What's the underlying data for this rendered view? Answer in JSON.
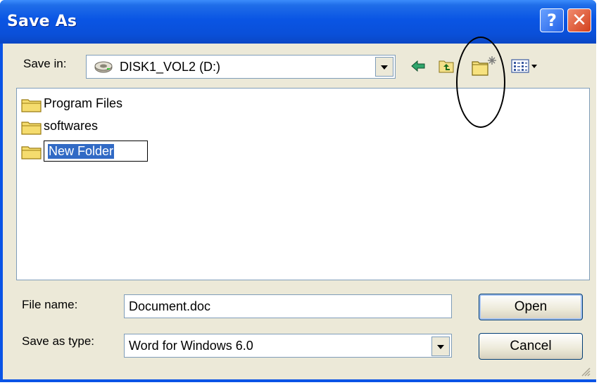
{
  "window": {
    "title": "Save As"
  },
  "titlebar_buttons": {
    "help": "?",
    "close": "✕"
  },
  "save_in": {
    "label": "Save in:",
    "value": "DISK1_VOL2 (D:)"
  },
  "toolbar": [
    "back-icon",
    "up-one-level-icon",
    "create-new-folder-icon",
    "views-menu-icon"
  ],
  "files": [
    {
      "name": "Program Files",
      "icon": "folder-icon"
    },
    {
      "name": "softwares",
      "icon": "folder-icon"
    },
    {
      "name": "New Folder",
      "icon": "folder-icon",
      "renaming": true
    }
  ],
  "file_name": {
    "label": "File name:",
    "value": "Document.doc"
  },
  "save_as_type": {
    "label": "Save as type:",
    "value": "Word for Windows 6.0"
  },
  "buttons": {
    "open": "Open",
    "cancel": "Cancel"
  },
  "colors": {
    "titlebar": "#0a55e4",
    "client": "#ece9d8",
    "selection": "#316ac5"
  }
}
